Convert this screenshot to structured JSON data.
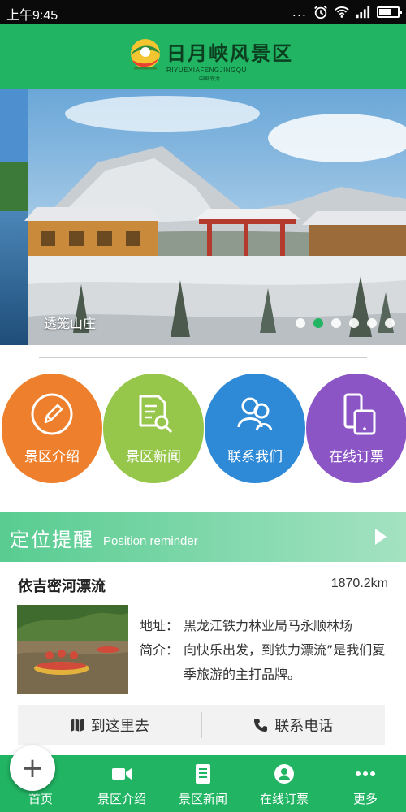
{
  "status_bar": {
    "time": "上午9:45",
    "dots": "...",
    "icons": [
      "alarm-icon",
      "wifi-icon",
      "signal-icon",
      "battery-icon"
    ]
  },
  "header": {
    "title": "日月峡风景区",
    "subtitle": "RIYUEXIAFENGJINGQU",
    "tiny": "中国·铁力"
  },
  "carousel": {
    "caption": "透笼山庄",
    "slide_count": 6,
    "active_index": 1
  },
  "quick_links": [
    {
      "label": "景区介绍",
      "color": "#ee7f2d",
      "icon": "pencil-icon"
    },
    {
      "label": "景区新闻",
      "color": "#96c64a",
      "icon": "document-search-icon"
    },
    {
      "label": "联系我们",
      "color": "#2e8ad6",
      "icon": "contacts-icon"
    },
    {
      "label": "在线订票",
      "color": "#8c55c6",
      "icon": "phone-tablet-icon"
    }
  ],
  "reminder": {
    "title": "定位提醒",
    "subtitle": "Position reminder"
  },
  "location": {
    "name": "依吉密河漂流",
    "distance": "1870.2km",
    "address_label": "地址：",
    "address": "黑龙江铁力林业局马永顺林场",
    "intro_label": "简介：",
    "intro": "向快乐出发，到铁力漂流”是我们夏季旅游的主打品牌。",
    "actions": {
      "go": "到这里去",
      "call": "联系电话"
    }
  },
  "bottom_nav": [
    {
      "label": "首页",
      "icon": "home-icon"
    },
    {
      "label": "景区介绍",
      "icon": "video-icon"
    },
    {
      "label": "景区新闻",
      "icon": "news-icon"
    },
    {
      "label": "在线订票",
      "icon": "user-icon"
    },
    {
      "label": "更多",
      "icon": "more-icon"
    }
  ],
  "fab": {
    "symbol": "+"
  },
  "colors": {
    "brand_green": "#21b463",
    "active_dot": "#21b463"
  }
}
